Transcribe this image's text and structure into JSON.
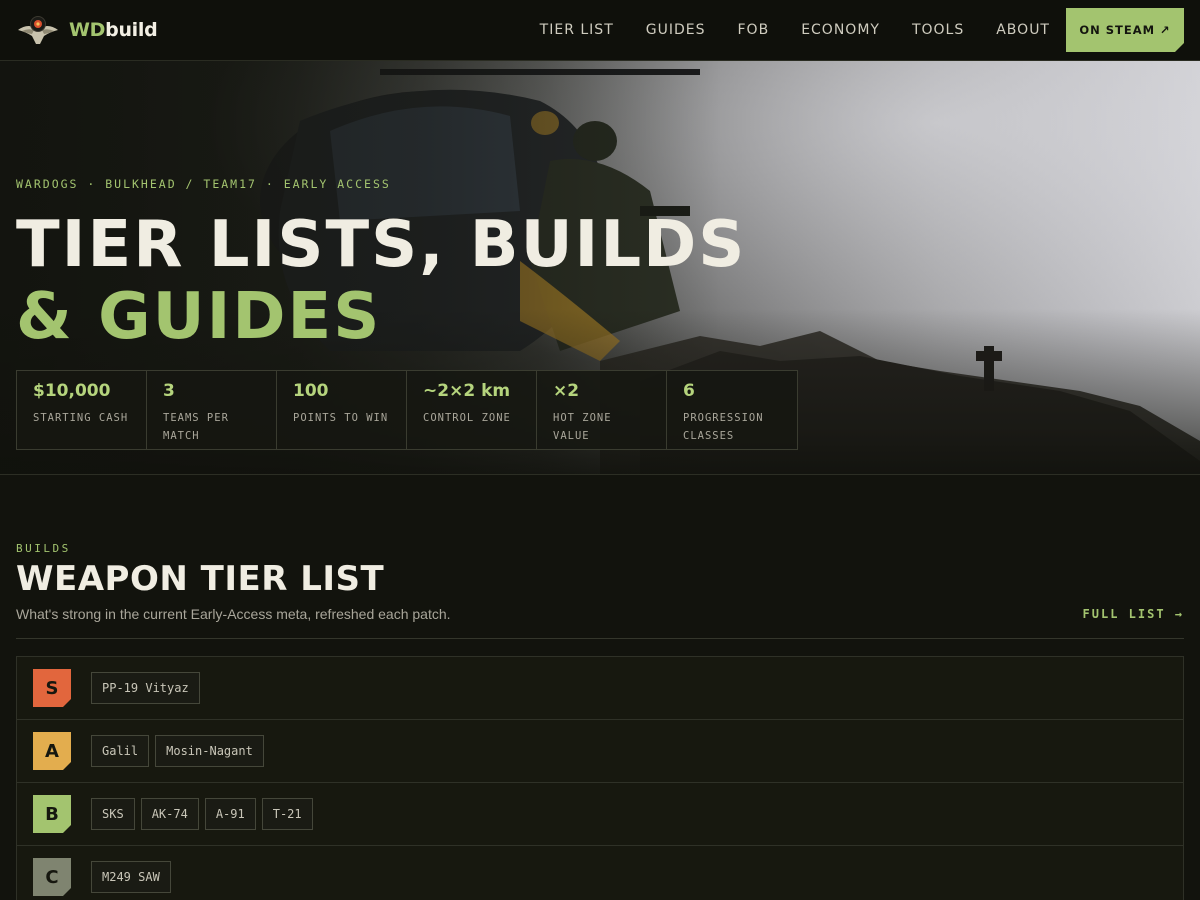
{
  "nav": {
    "logo_part1": "WD",
    "logo_part2": "build",
    "links": [
      "TIER LIST",
      "GUIDES",
      "FOB",
      "ECONOMY",
      "TOOLS",
      "ABOUT"
    ],
    "cta": "ON STEAM",
    "cta_icon": "↗"
  },
  "hero": {
    "kicker": "WARDOGS · BULKHEAD / TEAM17 · EARLY ACCESS",
    "title_line1": "TIER LISTS, BUILDS",
    "title_line2": "& GUIDES",
    "stats": [
      {
        "value": "$10,000",
        "label": "STARTING CASH"
      },
      {
        "value": "3",
        "label": "TEAMS PER MATCH"
      },
      {
        "value": "100",
        "label": "POINTS TO WIN"
      },
      {
        "value": "~2×2 km",
        "label": "CONTROL ZONE"
      },
      {
        "value": "×2",
        "label": "HOT ZONE VALUE"
      },
      {
        "value": "6",
        "label": "PROGRESSION CLASSES"
      }
    ]
  },
  "section": {
    "kicker": "BUILDS",
    "title": "WEAPON TIER LIST",
    "subtitle": "What's strong in the current Early-Access meta, refreshed each patch.",
    "link": "FULL LIST →"
  },
  "tiers": [
    {
      "tier": "S",
      "color": "#e2663d",
      "weapons": [
        "PP-19 Vityaz"
      ]
    },
    {
      "tier": "A",
      "color": "#e3ad4e",
      "weapons": [
        "Galil",
        "Mosin-Nagant"
      ]
    },
    {
      "tier": "B",
      "color": "#a3c46f",
      "weapons": [
        "SKS",
        "AK-74",
        "A-91",
        "T-21"
      ]
    },
    {
      "tier": "C",
      "color": "#7f8470",
      "weapons": [
        "M249 SAW"
      ]
    }
  ],
  "colors": {
    "accent": "#a3c46f",
    "background": "#12130d"
  }
}
